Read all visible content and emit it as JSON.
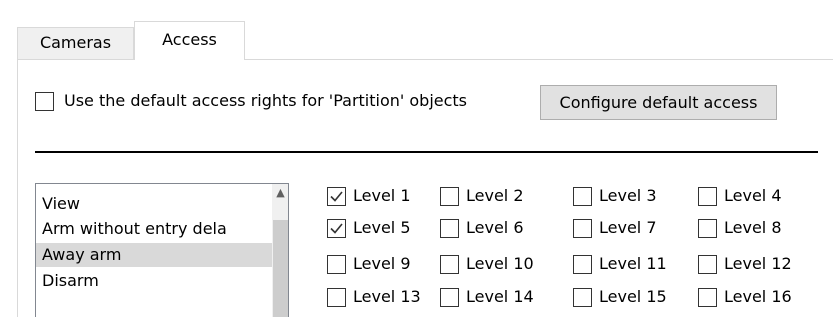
{
  "tabs": [
    {
      "label": "Cameras",
      "active": false
    },
    {
      "label": "Access",
      "active": true
    }
  ],
  "default_access": {
    "checkbox_label": "Use the default access rights for 'Partition' objects",
    "checked": false,
    "configure_button_label": "Configure default access"
  },
  "rights_list": {
    "items": [
      {
        "label": "View"
      },
      {
        "label": "Arm without entry dela"
      },
      {
        "label": "Away arm",
        "selected": true
      },
      {
        "label": "Disarm"
      }
    ]
  },
  "levels": [
    {
      "label": "Level 1",
      "checked": true
    },
    {
      "label": "Level 2",
      "checked": false
    },
    {
      "label": "Level 3",
      "checked": false
    },
    {
      "label": "Level 4",
      "checked": false
    },
    {
      "label": "Level 5",
      "checked": true
    },
    {
      "label": "Level 6",
      "checked": false
    },
    {
      "label": "Level 7",
      "checked": false
    },
    {
      "label": "Level 8",
      "checked": false
    },
    {
      "label": "Level 9",
      "checked": false
    },
    {
      "label": "Level 10",
      "checked": false
    },
    {
      "label": "Level 11",
      "checked": false
    },
    {
      "label": "Level 12",
      "checked": false
    },
    {
      "label": "Level 13",
      "checked": false
    },
    {
      "label": "Level 14",
      "checked": false
    },
    {
      "label": "Level 15",
      "checked": false
    },
    {
      "label": "Level 16",
      "checked": false
    }
  ]
}
